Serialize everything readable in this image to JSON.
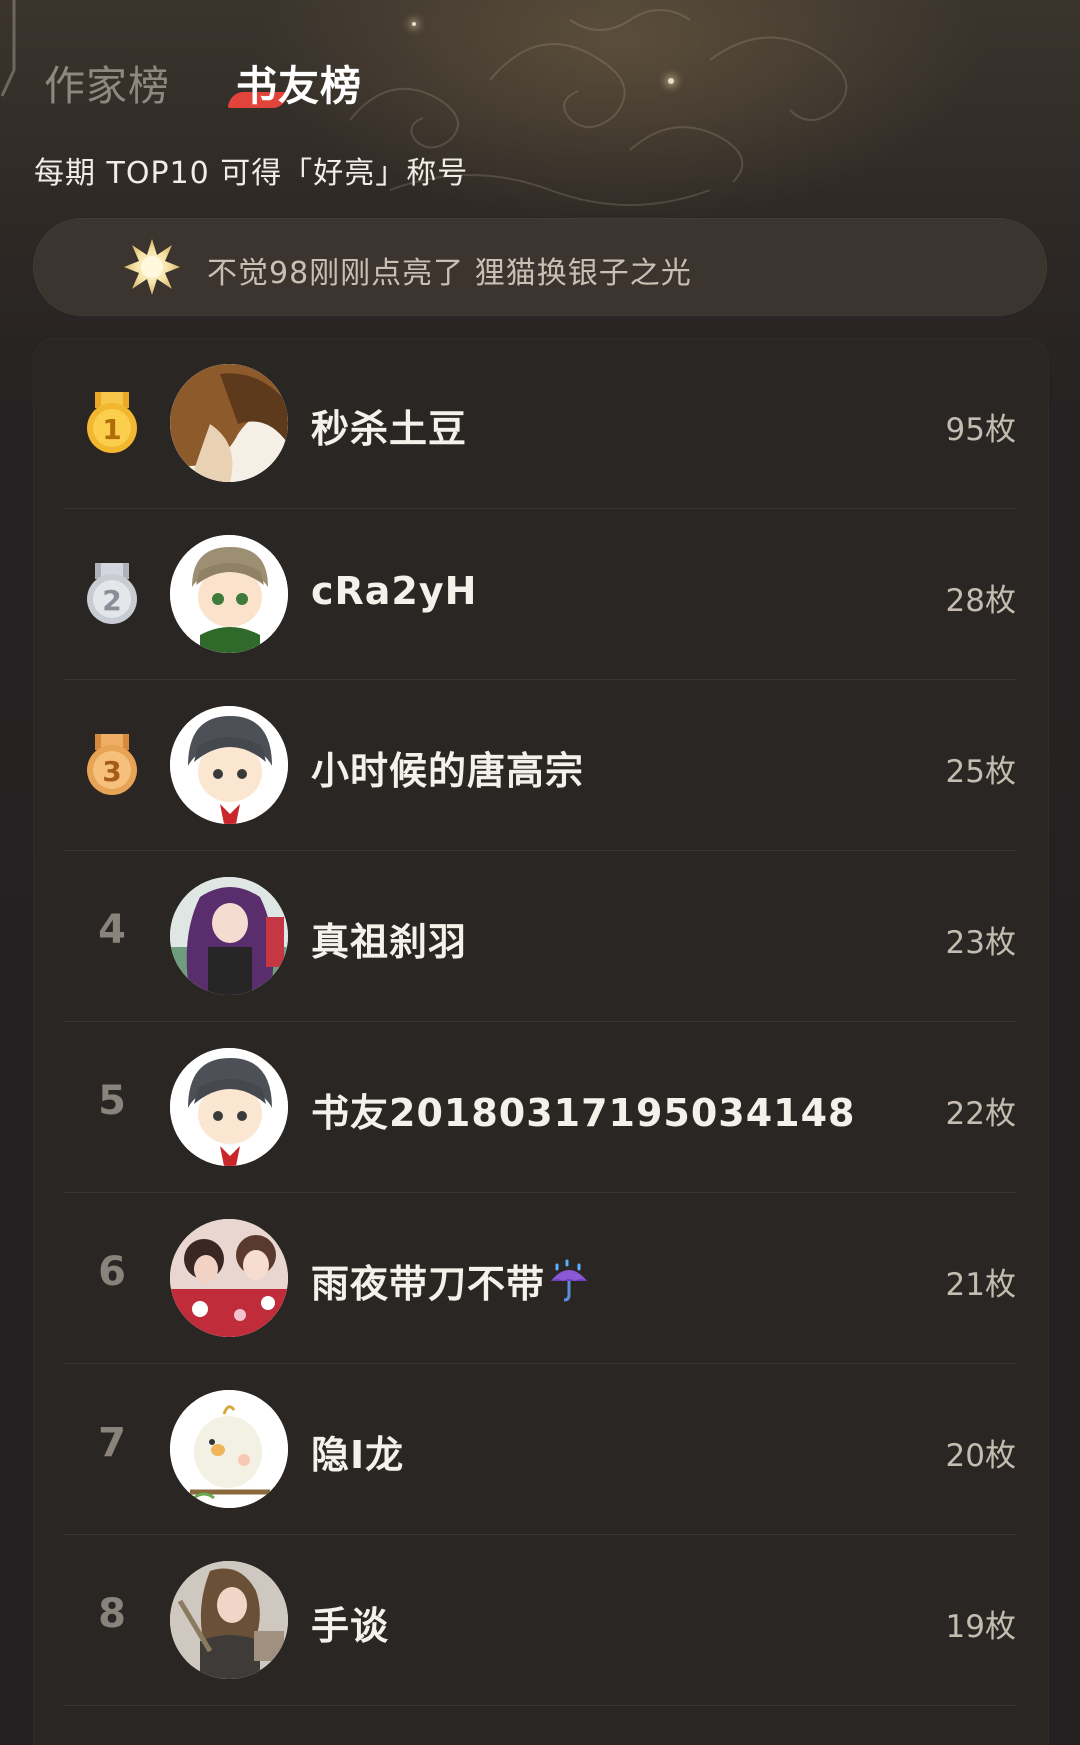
{
  "tabs": [
    {
      "label": "作家榜",
      "active": false
    },
    {
      "label": "书友榜",
      "active": true
    }
  ],
  "subtitle": "每期 TOP10 可得「好亮」称号",
  "notice": {
    "text": "不觉98刚刚点亮了 狸猫换银子之光",
    "icon": "sparkle-badge-icon"
  },
  "colors": {
    "background": "#242021",
    "card": "#2a2624",
    "active_tab_mark": "#e2443c",
    "gold": "#f2b631",
    "silver": "#c9ccd3",
    "bronze": "#e8a456"
  },
  "ranking": [
    {
      "rank": "1",
      "medal": "gold",
      "name": "秒杀土豆",
      "count": "95枚",
      "avatar": "anime-boy-brown-avatar"
    },
    {
      "rank": "2",
      "medal": "silver",
      "name": "cRa2yH",
      "count": "28枚",
      "avatar": "chibi-green-shirt-avatar"
    },
    {
      "rank": "3",
      "medal": "bronze",
      "name": "小时候的唐高宗",
      "count": "25枚",
      "avatar": "chibi-ribbon-avatar"
    },
    {
      "rank": "4",
      "medal": "",
      "name": "真祖刹羽",
      "count": "23枚",
      "avatar": "purple-hair-girl-avatar"
    },
    {
      "rank": "5",
      "medal": "",
      "name": "书友20180317195034148",
      "count": "22枚",
      "avatar": "chibi-ribbon-avatar"
    },
    {
      "rank": "6",
      "medal": "",
      "name": "雨夜带刀不带",
      "count": "21枚",
      "avatar": "kimono-photo-avatar",
      "emoji": "umbrella-rain-icon"
    },
    {
      "rank": "7",
      "medal": "",
      "name": "隐I龙",
      "count": "20枚",
      "avatar": "white-bird-avatar"
    },
    {
      "rank": "8",
      "medal": "",
      "name": "手谈",
      "count": "19枚",
      "avatar": "girl-photo-avatar"
    }
  ]
}
